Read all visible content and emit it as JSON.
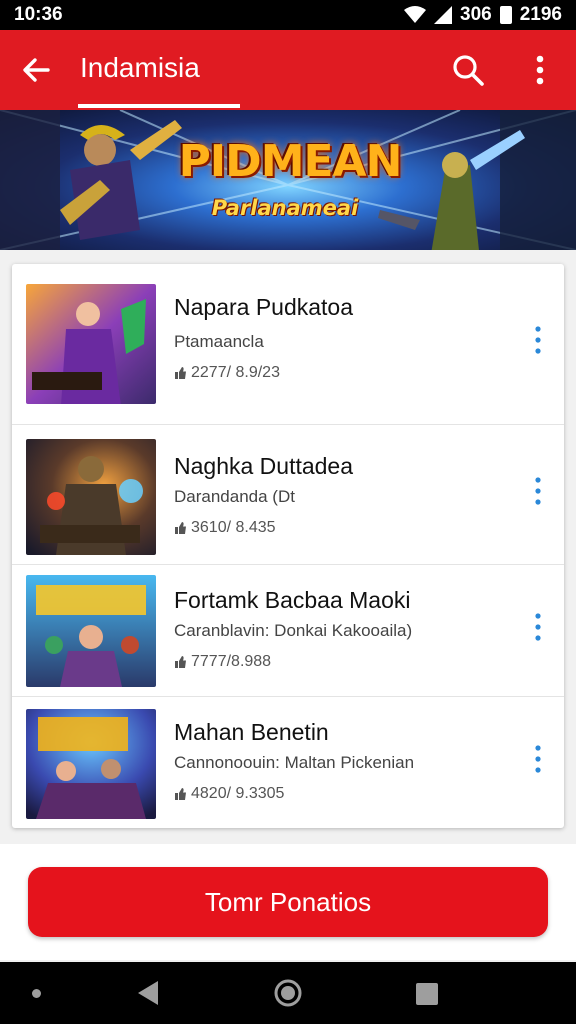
{
  "status_bar": {
    "time": "10:36",
    "signal_text": "306",
    "battery_text": "2196"
  },
  "app_bar": {
    "title": "Indamisia",
    "back_icon": "arrow-left-icon",
    "search_icon": "search-icon",
    "more_icon": "more-vertical-icon",
    "color": "#e01b22"
  },
  "banner": {
    "title": "PIDMEAN",
    "subtitle": "Parlanameai"
  },
  "items": [
    {
      "title": "Napara Pudkatoa",
      "subtitle": "Ptamaancla",
      "stat": "2277/ 8.9/23"
    },
    {
      "title": "Naghka Duttadea",
      "subtitle": "Darandanda (Dt",
      "stat": "3610/ 8.435"
    },
    {
      "title": "Fortamk Bacbaa Maoki",
      "subtitle": "Caranblavin: Donkai Kakooaila)",
      "stat": "7777/8.988"
    },
    {
      "title": "Mahan Benetin",
      "subtitle": "Cannonoouin: Maltan Pickenian",
      "stat": "4820/ 9.3305"
    }
  ],
  "primary_button": {
    "label": "Tomr Ponatios",
    "color": "#e5131c"
  },
  "nav_bar": {
    "back_icon": "nav-back-icon",
    "home_icon": "nav-home-icon",
    "recents_icon": "nav-recents-icon"
  }
}
